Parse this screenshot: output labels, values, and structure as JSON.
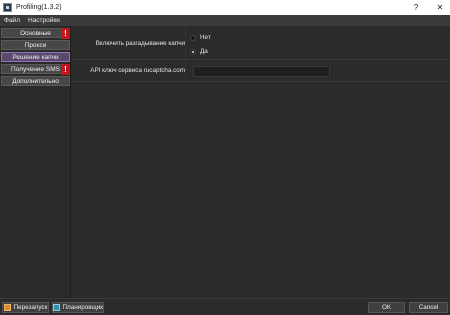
{
  "window": {
    "title": "Profiling(1.3.2)",
    "help_glyph": "?",
    "close_glyph": "✕",
    "icon": "app-icon"
  },
  "menubar": {
    "items": [
      "Файл",
      "Настройки"
    ]
  },
  "sidebar": {
    "items": [
      {
        "label": "Основные",
        "warning": true
      },
      {
        "label": "Прокси",
        "warning": false
      },
      {
        "label": "Решение капчи",
        "warning": false,
        "active": true
      },
      {
        "label": "Получение SMS",
        "warning": true
      },
      {
        "label": "Дополнительно",
        "warning": false
      }
    ],
    "warning_glyph": "!",
    "accent_color": "#8e74b0",
    "warning_color": "#c2161f"
  },
  "settings": {
    "captcha_toggle": {
      "label": "Включить разгадывание капчи",
      "options": [
        "Нет",
        "Да"
      ],
      "selected": "Да"
    },
    "api_key": {
      "label": "API ключ сервиса rucaptcha.com",
      "value": ""
    }
  },
  "bottom": {
    "restart_label": "Перезапуск",
    "scheduler_label": "Планировщик",
    "ok_label": "OK",
    "cancel_label": "Cancel"
  }
}
